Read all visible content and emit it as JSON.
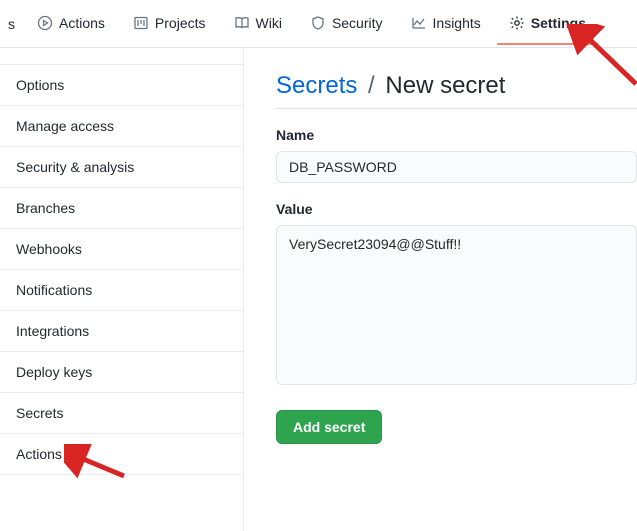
{
  "topnav": {
    "truncated": "s",
    "items": [
      {
        "label": "Actions",
        "icon": "play"
      },
      {
        "label": "Projects",
        "icon": "project"
      },
      {
        "label": "Wiki",
        "icon": "book"
      },
      {
        "label": "Security",
        "icon": "shield"
      },
      {
        "label": "Insights",
        "icon": "graph"
      },
      {
        "label": "Settings",
        "icon": "gear",
        "active": true
      }
    ]
  },
  "sidebar": {
    "items": [
      {
        "label": "Options"
      },
      {
        "label": "Manage access"
      },
      {
        "label": "Security & analysis"
      },
      {
        "label": "Branches"
      },
      {
        "label": "Webhooks"
      },
      {
        "label": "Notifications"
      },
      {
        "label": "Integrations"
      },
      {
        "label": "Deploy keys"
      },
      {
        "label": "Secrets"
      },
      {
        "label": "Actions"
      }
    ]
  },
  "main": {
    "breadcrumb_link": "Secrets",
    "breadcrumb_sep": "/",
    "breadcrumb_current": "New secret",
    "name_label": "Name",
    "name_value": "DB_PASSWORD",
    "value_label": "Value",
    "value_value": "VerySecret23094@@Stuff!!",
    "submit_label": "Add secret"
  },
  "annotations": {
    "arrow_color": "#d92424"
  }
}
